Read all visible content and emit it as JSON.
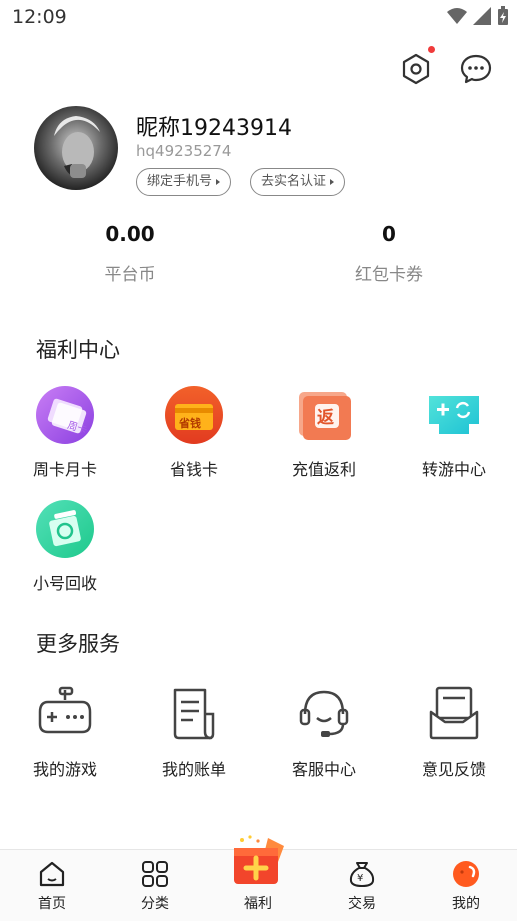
{
  "status_bar": {
    "time": "12:09"
  },
  "top_actions": {
    "settings_icon": "settings-hex-icon",
    "message_icon": "chat-bubble-icon",
    "accent": "#f03b3b"
  },
  "profile": {
    "nickname": "昵称19243914",
    "user_id": "hq49235274",
    "bind_phone_label": "绑定手机号",
    "verify_label": "去实名认证"
  },
  "stats": [
    {
      "value": "0.00",
      "label": "平台币"
    },
    {
      "value": "0",
      "label": "红包卡券"
    }
  ],
  "welfare": {
    "title": "福利中心",
    "items": [
      {
        "label": "周卡月卡",
        "icon": "weekly-card-icon"
      },
      {
        "label": "省钱卡",
        "icon": "saving-card-icon"
      },
      {
        "label": "充值返利",
        "icon": "rebate-icon"
      },
      {
        "label": "转游中心",
        "icon": "transfer-game-icon"
      },
      {
        "label": "小号回收",
        "icon": "recycle-icon"
      }
    ]
  },
  "services": {
    "title": "更多服务",
    "items": [
      {
        "label": "我的游戏",
        "icon": "gamepad-icon"
      },
      {
        "label": "我的账单",
        "icon": "bill-icon"
      },
      {
        "label": "客服中心",
        "icon": "headset-icon"
      },
      {
        "label": "意见反馈",
        "icon": "feedback-icon"
      }
    ]
  },
  "tabbar": [
    {
      "label": "首页",
      "icon": "home-icon"
    },
    {
      "label": "分类",
      "icon": "category-icon"
    },
    {
      "label": "福利",
      "icon": "gift-icon"
    },
    {
      "label": "交易",
      "icon": "money-bag-icon"
    },
    {
      "label": "我的",
      "icon": "profile-icon"
    }
  ]
}
